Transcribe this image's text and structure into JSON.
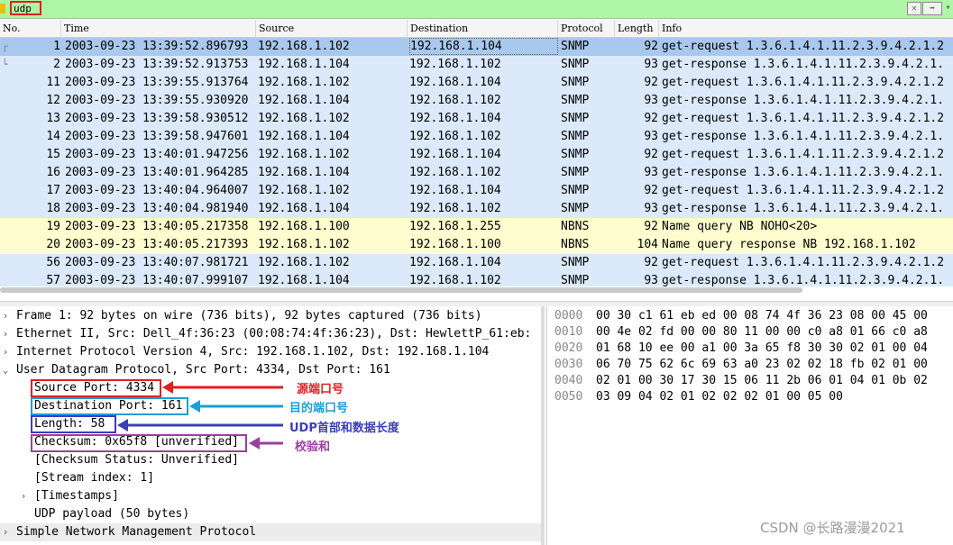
{
  "filter": {
    "value": "udp"
  },
  "packet_list": {
    "columns": [
      "No.",
      "Time",
      "Source",
      "Destination",
      "Protocol",
      "Length",
      "Info"
    ],
    "rows": [
      {
        "no": "1",
        "time": "2003-09-23 13:39:52.896793",
        "src": "192.168.1.102",
        "dst": "192.168.1.104",
        "proto": "SNMP",
        "len": "92",
        "info": "get-request 1.3.6.1.4.1.11.2.3.9.4.2.1.2"
      },
      {
        "no": "2",
        "time": "2003-09-23 13:39:52.913753",
        "src": "192.168.1.104",
        "dst": "192.168.1.102",
        "proto": "SNMP",
        "len": "93",
        "info": "get-response 1.3.6.1.4.1.11.2.3.9.4.2.1."
      },
      {
        "no": "11",
        "time": "2003-09-23 13:39:55.913764",
        "src": "192.168.1.102",
        "dst": "192.168.1.104",
        "proto": "SNMP",
        "len": "92",
        "info": "get-request 1.3.6.1.4.1.11.2.3.9.4.2.1.2"
      },
      {
        "no": "12",
        "time": "2003-09-23 13:39:55.930920",
        "src": "192.168.1.104",
        "dst": "192.168.1.102",
        "proto": "SNMP",
        "len": "93",
        "info": "get-response 1.3.6.1.4.1.11.2.3.9.4.2.1."
      },
      {
        "no": "13",
        "time": "2003-09-23 13:39:58.930512",
        "src": "192.168.1.102",
        "dst": "192.168.1.104",
        "proto": "SNMP",
        "len": "92",
        "info": "get-request 1.3.6.1.4.1.11.2.3.9.4.2.1.2"
      },
      {
        "no": "14",
        "time": "2003-09-23 13:39:58.947601",
        "src": "192.168.1.104",
        "dst": "192.168.1.102",
        "proto": "SNMP",
        "len": "93",
        "info": "get-response 1.3.6.1.4.1.11.2.3.9.4.2.1."
      },
      {
        "no": "15",
        "time": "2003-09-23 13:40:01.947256",
        "src": "192.168.1.102",
        "dst": "192.168.1.104",
        "proto": "SNMP",
        "len": "92",
        "info": "get-request 1.3.6.1.4.1.11.2.3.9.4.2.1.2"
      },
      {
        "no": "16",
        "time": "2003-09-23 13:40:01.964285",
        "src": "192.168.1.104",
        "dst": "192.168.1.102",
        "proto": "SNMP",
        "len": "93",
        "info": "get-response 1.3.6.1.4.1.11.2.3.9.4.2.1."
      },
      {
        "no": "17",
        "time": "2003-09-23 13:40:04.964007",
        "src": "192.168.1.102",
        "dst": "192.168.1.104",
        "proto": "SNMP",
        "len": "92",
        "info": "get-request 1.3.6.1.4.1.11.2.3.9.4.2.1.2"
      },
      {
        "no": "18",
        "time": "2003-09-23 13:40:04.981940",
        "src": "192.168.1.104",
        "dst": "192.168.1.102",
        "proto": "SNMP",
        "len": "93",
        "info": "get-response 1.3.6.1.4.1.11.2.3.9.4.2.1."
      },
      {
        "no": "19",
        "time": "2003-09-23 13:40:05.217358",
        "src": "192.168.1.100",
        "dst": "192.168.1.255",
        "proto": "NBNS",
        "len": "92",
        "info": "Name query NB NOHO<20>"
      },
      {
        "no": "20",
        "time": "2003-09-23 13:40:05.217393",
        "src": "192.168.1.102",
        "dst": "192.168.1.100",
        "proto": "NBNS",
        "len": "104",
        "info": "Name query response NB 192.168.1.102"
      },
      {
        "no": "56",
        "time": "2003-09-23 13:40:07.981721",
        "src": "192.168.1.102",
        "dst": "192.168.1.104",
        "proto": "SNMP",
        "len": "92",
        "info": "get-request 1.3.6.1.4.1.11.2.3.9.4.2.1.2"
      },
      {
        "no": "57",
        "time": "2003-09-23 13:40:07.999107",
        "src": "192.168.1.104",
        "dst": "192.168.1.102",
        "proto": "SNMP",
        "len": "93",
        "info": "get-response 1.3.6.1.4.1.11.2.3.9.4.2.1."
      }
    ]
  },
  "details": {
    "frame": "Frame 1: 92 bytes on wire (736 bits), 92 bytes captured (736 bits)",
    "ethernet": "Ethernet II, Src: Dell_4f:36:23 (00:08:74:4f:36:23), Dst: HewlettP_61:eb:",
    "ip": "Internet Protocol Version 4, Src: 192.168.1.102, Dst: 192.168.1.104",
    "udp": "User Datagram Protocol, Src Port: 4334, Dst Port: 161",
    "src_port": "Source Port: 4334",
    "dst_port": "Destination Port: 161",
    "length": "Length: 58",
    "checksum": "Checksum: 0x65f8 [unverified]",
    "checksum_status": "[Checksum Status: Unverified]",
    "stream_index": "[Stream index: 1]",
    "timestamps": "[Timestamps]",
    "payload": "UDP payload (50 bytes)",
    "snmp": "Simple Network Management Protocol"
  },
  "hex": [
    {
      "offset": "0000",
      "bytes": "00 30 c1 61 eb ed 00 08  74 4f 36 23 08 00 45 00"
    },
    {
      "offset": "0010",
      "bytes": "00 4e 02 fd 00 00 80 11  00 00 c0 a8 01 66 c0 a8"
    },
    {
      "offset": "0020",
      "bytes": "01 68 10 ee 00 a1 00 3a  65 f8 30 30 02 01 00 04"
    },
    {
      "offset": "0030",
      "bytes": "06 70 75 62 6c 69 63 a0  23 02 02 18 fb 02 01 00"
    },
    {
      "offset": "0040",
      "bytes": "02 01 00 30 17 30 15 06  11 2b 06 01 04 01 0b 02"
    },
    {
      "offset": "0050",
      "bytes": "03 09 04 02 01 02 02 02  01 00 05 00"
    }
  ],
  "annotations": {
    "src_port": "源端口号",
    "dst_port": "目的端口号",
    "length": "UDP首部和数据长度",
    "checksum": "校验和"
  },
  "watermark": "CSDN @长路漫漫2021",
  "colors": {
    "snmp_row": "#dbe9fa",
    "nbns_row": "#fdfdcf",
    "selected_row": "#a8c8ee",
    "filter_bar": "#aef5a6",
    "red": "#e02020",
    "cyan": "#1a9fd8",
    "blue": "#3b3fb8",
    "purple": "#9a3fa0"
  },
  "icons": [
    "clear-filter-icon",
    "apply-filter-icon",
    "expand-icon",
    "collapse-icon",
    "related-packet-icon"
  ]
}
